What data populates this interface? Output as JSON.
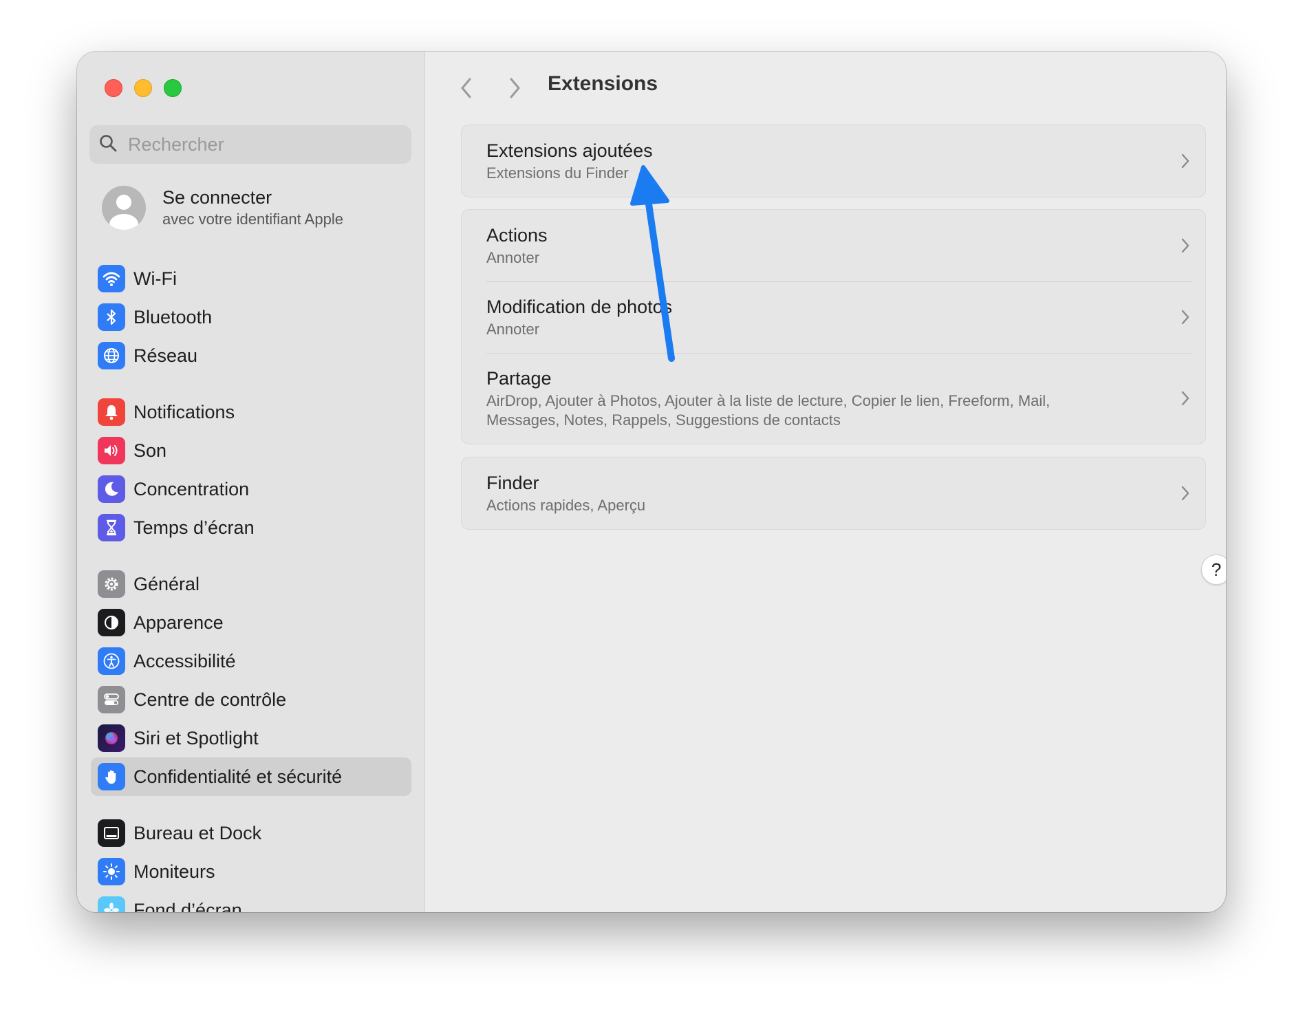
{
  "search": {
    "placeholder": "Rechercher"
  },
  "account": {
    "title": "Se connecter",
    "subtitle": "avec votre identifiant Apple"
  },
  "sidebar": {
    "items": [
      {
        "label": "Wi-Fi",
        "icon": "wifi-icon",
        "color": "#2f7cf6"
      },
      {
        "label": "Bluetooth",
        "icon": "bluetooth-icon",
        "color": "#2f7cf6"
      },
      {
        "label": "Réseau",
        "icon": "globe-icon",
        "color": "#2f7cf6"
      },
      {
        "label": "Notifications",
        "icon": "bell-icon",
        "color": "#f0453a"
      },
      {
        "label": "Son",
        "icon": "speaker-icon",
        "color": "#f0365a"
      },
      {
        "label": "Concentration",
        "icon": "moon-icon",
        "color": "#5e5ce6"
      },
      {
        "label": "Temps d’écran",
        "icon": "hourglass-icon",
        "color": "#5e5ce6"
      },
      {
        "label": "Général",
        "icon": "gear-icon",
        "color": "#8e8e93"
      },
      {
        "label": "Apparence",
        "icon": "appearance-icon",
        "color": "#1c1c1e"
      },
      {
        "label": "Accessibilité",
        "icon": "accessibility-icon",
        "color": "#2f7cf6"
      },
      {
        "label": "Centre de contrôle",
        "icon": "control-center-icon",
        "color": "#8e8e93"
      },
      {
        "label": "Siri et Spotlight",
        "icon": "siri-icon",
        "color": "#6b2fbf"
      },
      {
        "label": "Confidentialité et sécurité",
        "icon": "hand-icon",
        "color": "#2f7cf6"
      },
      {
        "label": "Bureau et Dock",
        "icon": "dock-icon",
        "color": "#1c1c1e"
      },
      {
        "label": "Moniteurs",
        "icon": "sun-icon",
        "color": "#2f7cf6"
      },
      {
        "label": "Fond d’écran",
        "icon": "wallpaper-icon",
        "color": "#5ac8fa"
      }
    ],
    "selected": "Confidentialité et sécurité"
  },
  "header": {
    "title": "Extensions"
  },
  "groups": [
    {
      "rows": [
        {
          "title": "Extensions ajoutées",
          "subtitle": "Extensions du Finder"
        }
      ]
    },
    {
      "rows": [
        {
          "title": "Actions",
          "subtitle": "Annoter"
        },
        {
          "title": "Modification de photos",
          "subtitle": "Annoter"
        },
        {
          "title": "Partage",
          "subtitle": "AirDrop, Ajouter à Photos, Ajouter à la liste de lecture, Copier le lien, Freeform, Mail, Messages, Notes, Rappels, Suggestions de contacts"
        }
      ]
    },
    {
      "rows": [
        {
          "title": "Finder",
          "subtitle": "Actions rapides, Aperçu"
        }
      ]
    }
  ],
  "help": {
    "label": "?"
  },
  "colors": {
    "annotation_arrow": "#1a7cf0"
  }
}
